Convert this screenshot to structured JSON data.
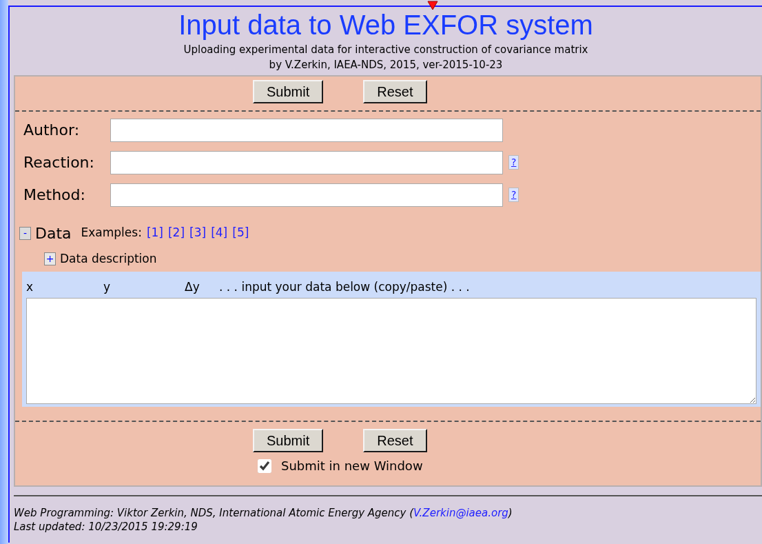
{
  "header": {
    "title": "Input data to Web EXFOR system",
    "subtitle_lines": [
      "Uploading experimental data for interactive construction of covariance matrix",
      "by V.Zerkin, IAEA-NDS, 2015, ver-2015-10-23"
    ]
  },
  "top_buttons": [
    {
      "label": "Submit"
    },
    {
      "label": "Reset"
    }
  ],
  "fields": [
    {
      "label": "Author:"
    },
    {
      "label": "Reaction:",
      "help": "?"
    },
    {
      "label": "Method:",
      "help": "?"
    }
  ],
  "data_section": {
    "toggle": "-",
    "title": "Data",
    "expanded": true,
    "examples_label": "Examples:",
    "examples": [
      "[1]",
      "[2]",
      "[3]",
      "[4]",
      "[5]"
    ],
    "description": {
      "toggle": "+",
      "label": "Data description",
      "expanded": false
    },
    "columns_header": [
      "x",
      "y",
      "Δy",
      ". . . input your data below (copy/paste) . . ."
    ]
  },
  "bottom_buttons": [
    {
      "label": "Submit"
    },
    {
      "label": "Reset"
    }
  ],
  "new_window": {
    "label": "Submit in new Window",
    "checked": true
  },
  "footer": {
    "credit_prefix": "Web Programming: Viktor Zerkin, NDS, International Atomic Energy Agency (",
    "email": "V.Zerkin@iaea.org",
    "credit_suffix": ")",
    "updated": "Last updated: 10/23/2015 19:29:19"
  }
}
